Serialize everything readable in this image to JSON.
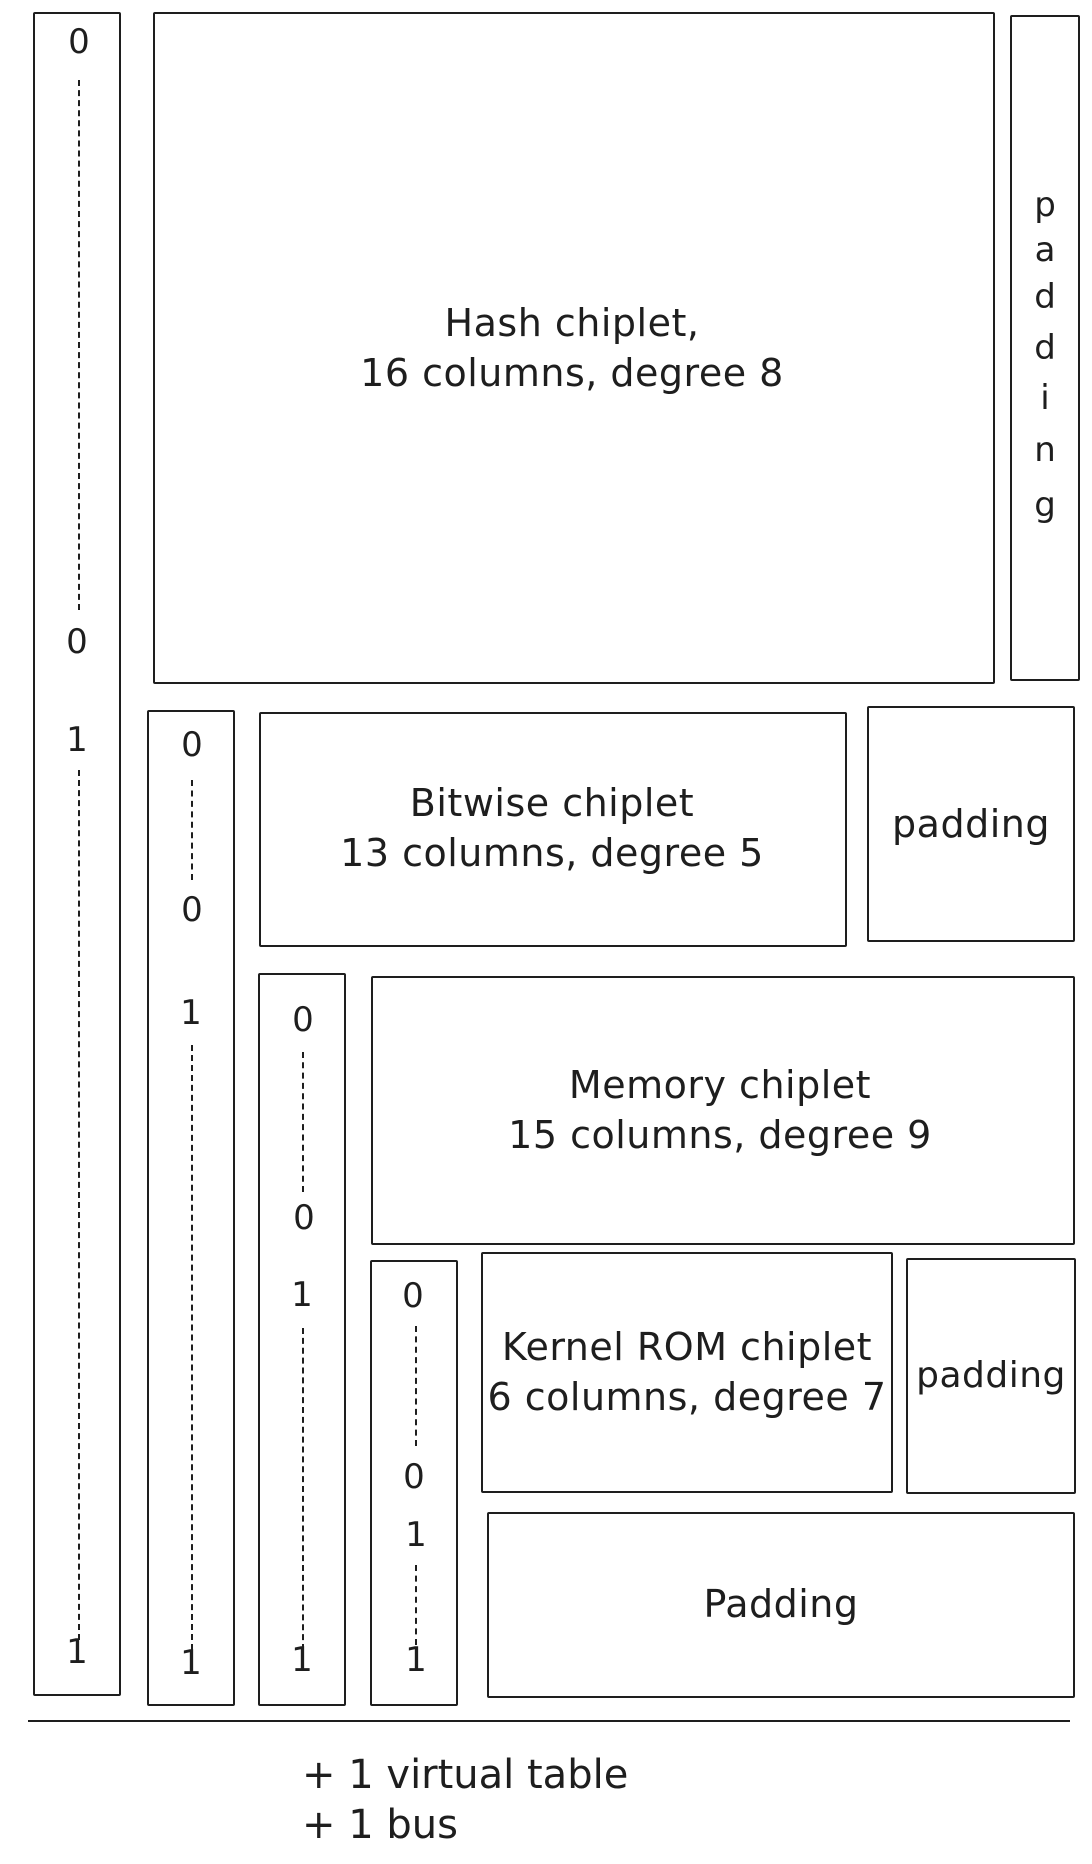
{
  "chiplets": {
    "hash": {
      "title": "Hash chiplet,",
      "detail": "16 columns, degree 8"
    },
    "bitwise": {
      "title": "Bitwise chiplet",
      "detail": "13 columns, degree 5"
    },
    "memory": {
      "title": "Memory chiplet",
      "detail": "15 columns, degree 9"
    },
    "kernel_rom": {
      "title": "Kernel ROM chiplet",
      "detail": "6 columns, degree 7"
    }
  },
  "padding_labels": {
    "hash_side": [
      "p",
      "a",
      "d",
      "d",
      "i",
      "n",
      "g"
    ],
    "bitwise_side": "padding",
    "kernel_side": "padding",
    "bottom": "Padding"
  },
  "selectors": {
    "s0": {
      "top": "0",
      "mid0": "0",
      "mid1": "1",
      "bottom": "1"
    },
    "s1": {
      "top": "0",
      "mid0": "0",
      "mid1": "1",
      "bottom": "1"
    },
    "s2": {
      "top": "0",
      "mid0": "0",
      "mid1": "1",
      "bottom": "1"
    },
    "s3": {
      "top": "0",
      "mid0": "0",
      "mid1": "1",
      "bottom": "1"
    }
  },
  "footer": {
    "line1": "+ 1 virtual table",
    "line2": "+ 1 bus"
  }
}
